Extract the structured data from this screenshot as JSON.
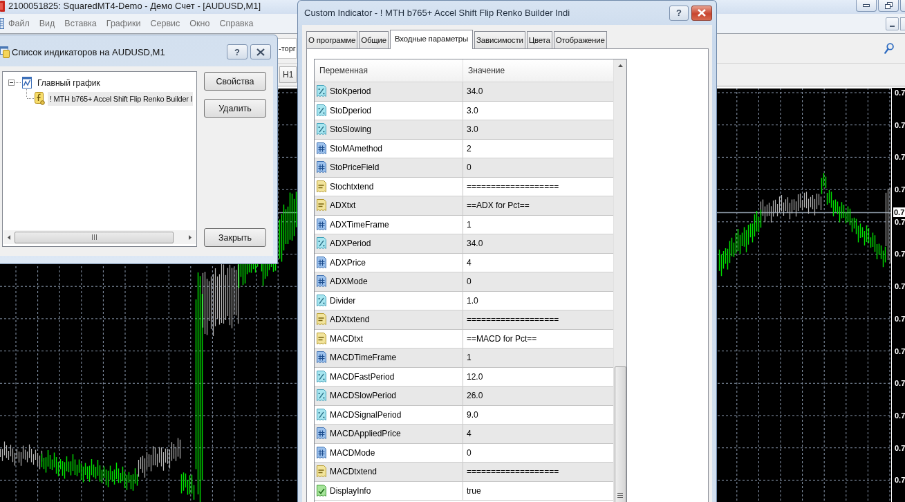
{
  "app": {
    "title": "2100051825: SquaredMT4-Demo - Демо Счет - [AUDUSD,M1]",
    "menu": [
      "Файл",
      "Вид",
      "Вставка",
      "Графики",
      "Сервис",
      "Окно",
      "Справка"
    ],
    "toolbar": [
      {
        "label": "-торг"
      },
      {
        "label": "H1"
      }
    ]
  },
  "chart": {
    "price_labels": [
      "0.7",
      "0.7",
      "0.7",
      "0.7",
      "0.7",
      "0.7",
      "0.7",
      "0.7",
      "0.7",
      "0.7",
      "0.7",
      "0.7",
      "0.7"
    ],
    "current_price_label": "0.7"
  },
  "indicator_list_dialog": {
    "title": "Список индикаторов на AUDUSD,M1",
    "help_button": "?",
    "tree": [
      {
        "label": "Главный график",
        "expanded": true,
        "selected": false,
        "children": [
          {
            "label": "! MTH b765+ Accel Shift Flip Renko Builder I",
            "selected": true
          }
        ]
      }
    ],
    "buttons": [
      "Свойства",
      "Удалить",
      "Закрыть"
    ]
  },
  "indicator_dialog": {
    "title": "Custom Indicator - ! MTH b765+ Accel Shift Flip Renko Builder Indi",
    "help_button": "?",
    "tabs": [
      {
        "label": "О программе",
        "selected": false
      },
      {
        "label": "Общие",
        "selected": false
      },
      {
        "label": "Входные параметры",
        "selected": true
      },
      {
        "label": "Зависимости",
        "selected": false
      },
      {
        "label": "Цвета",
        "selected": false
      },
      {
        "label": "Отображение",
        "selected": false
      }
    ],
    "table": {
      "columns": [
        "Переменная",
        "Значение"
      ],
      "rows": [
        {
          "kind": "double",
          "name": "StoKperiod",
          "value": "34.0"
        },
        {
          "kind": "double",
          "name": "StoDperiod",
          "value": "3.0"
        },
        {
          "kind": "double",
          "name": "StoSlowing",
          "value": "3.0"
        },
        {
          "kind": "int",
          "name": "StoMAmethod",
          "value": "2"
        },
        {
          "kind": "int",
          "name": "StoPriceField",
          "value": "0"
        },
        {
          "kind": "string",
          "name": "Stochtxtend",
          "value": "==================="
        },
        {
          "kind": "string",
          "name": "ADXtxt",
          "value": "==ADX for Pct=="
        },
        {
          "kind": "int",
          "name": "ADXTimeFrame",
          "value": "1"
        },
        {
          "kind": "double",
          "name": "ADXPeriod",
          "value": "34.0"
        },
        {
          "kind": "int",
          "name": "ADXPrice",
          "value": "4"
        },
        {
          "kind": "int",
          "name": "ADXMode",
          "value": "0"
        },
        {
          "kind": "double",
          "name": "Divider",
          "value": "1.0"
        },
        {
          "kind": "string",
          "name": "ADXtxtend",
          "value": "==================="
        },
        {
          "kind": "string",
          "name": "MACDtxt",
          "value": "==MACD for Pct=="
        },
        {
          "kind": "int",
          "name": "MACDTimeFrame",
          "value": "1"
        },
        {
          "kind": "double",
          "name": "MACDFastPeriod",
          "value": "12.0"
        },
        {
          "kind": "double",
          "name": "MACDSlowPeriod",
          "value": "26.0"
        },
        {
          "kind": "double",
          "name": "MACDSignalPeriod",
          "value": "9.0"
        },
        {
          "kind": "int",
          "name": "MACDAppliedPrice",
          "value": "4"
        },
        {
          "kind": "int",
          "name": "MACDMode",
          "value": "0"
        },
        {
          "kind": "string",
          "name": "MACDtxtend",
          "value": "==================="
        },
        {
          "kind": "bool",
          "name": "DisplayInfo",
          "value": "true"
        }
      ]
    }
  }
}
